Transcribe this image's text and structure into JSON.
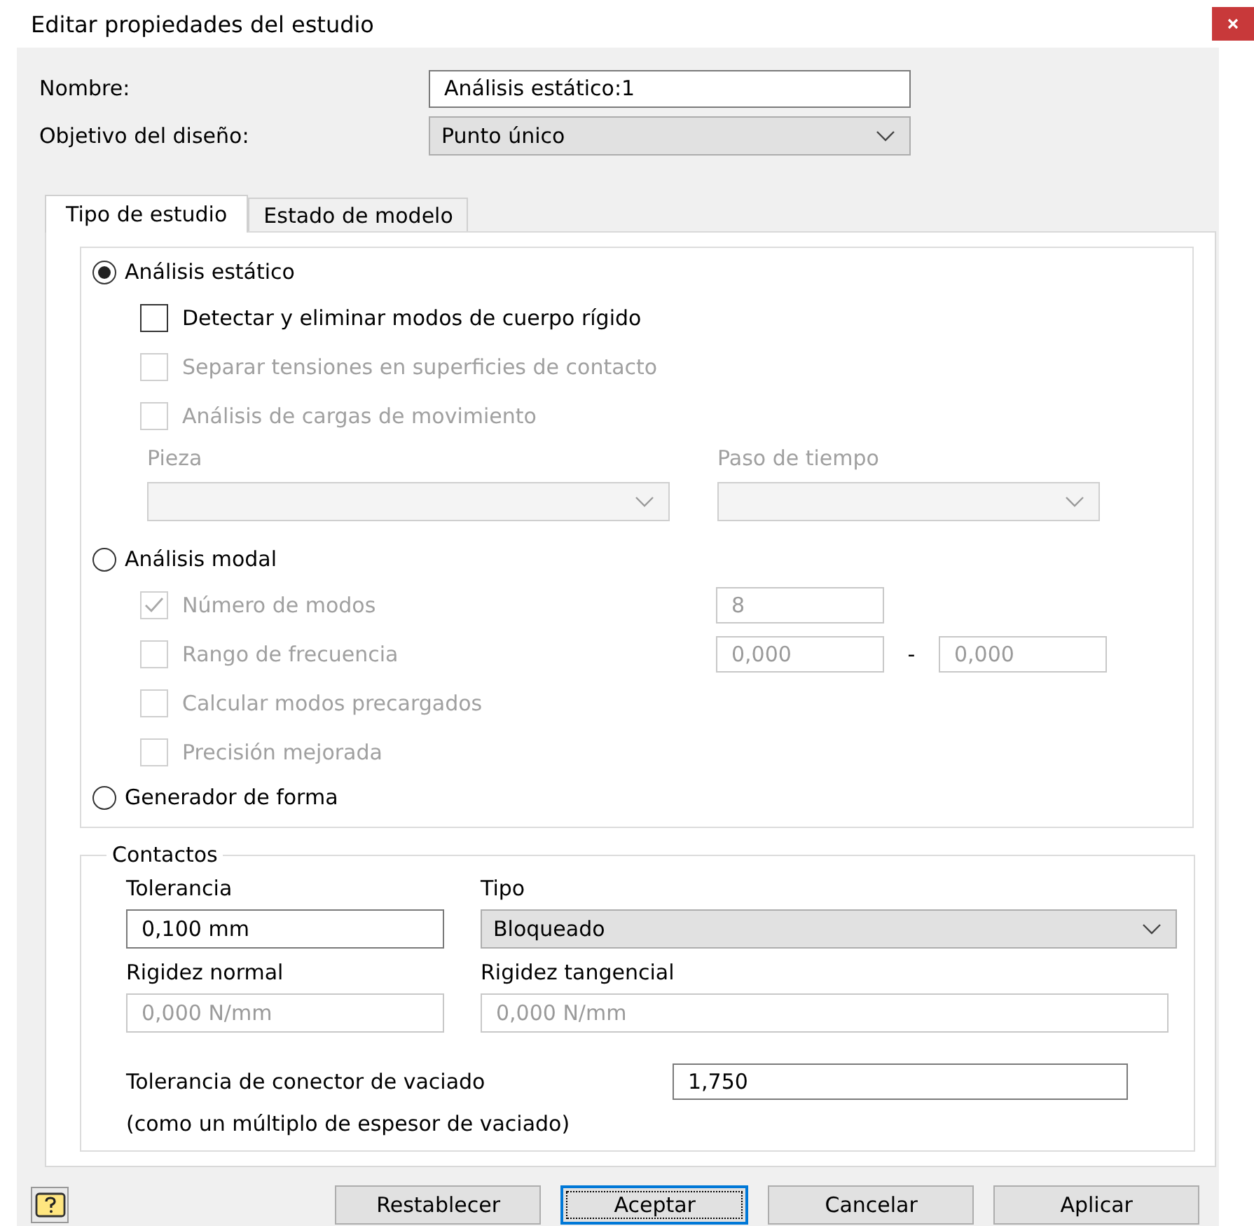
{
  "window": {
    "title": "Editar propiedades del estudio"
  },
  "name_field": {
    "label": "Nombre:",
    "value": "Análisis estático:1"
  },
  "objective_field": {
    "label": "Objetivo del diseño:",
    "value": "Punto único"
  },
  "tabs": [
    {
      "label": "Tipo de estudio",
      "selected": true
    },
    {
      "label": "Estado de modelo",
      "selected": false
    }
  ],
  "analysis_types": [
    {
      "label": "Análisis estático",
      "selected": true,
      "rows": [
        {
          "kind": "checkbox",
          "label": "Detectar y eliminar modos de cuerpo rígido",
          "checked": false,
          "disabled": false
        },
        {
          "kind": "checkbox",
          "label": "Separar tensiones en superficies de contacto",
          "checked": false,
          "disabled": true
        },
        {
          "kind": "checkbox",
          "label": "Análisis de cargas de movimiento",
          "checked": false,
          "disabled": true
        },
        {
          "kind": "selects",
          "selects": [
            {
              "label": "Pieza",
              "disabled": true
            },
            {
              "label": "Paso de tiempo",
              "disabled": true
            }
          ]
        }
      ]
    },
    {
      "label": "Análisis modal",
      "selected": false,
      "rows": [
        {
          "kind": "checkbox",
          "label": "Número de modos",
          "checked": true,
          "disabled": true,
          "values": [
            "8"
          ]
        },
        {
          "kind": "checkbox",
          "label": "Rango de frecuencia",
          "checked": false,
          "disabled": true,
          "values": [
            "0,000",
            "0,000"
          ],
          "separator": "-"
        },
        {
          "kind": "checkbox",
          "label": "Calcular modos precargados",
          "checked": false,
          "disabled": true
        },
        {
          "kind": "checkbox",
          "label": "Precisión mejorada",
          "checked": false,
          "disabled": true
        }
      ]
    },
    {
      "label": "Generador de forma",
      "selected": false
    }
  ],
  "contacts": {
    "title": "Contactos",
    "tolerance": {
      "label": "Tolerancia",
      "value": "0,100 mm",
      "disabled": false
    },
    "type": {
      "label": "Tipo",
      "value": "Bloqueado"
    },
    "normal_stiffness": {
      "label": "Rigidez normal",
      "value": "0,000 N/mm",
      "disabled": true
    },
    "tangential_stiffness": {
      "label": "Rigidez tangencial",
      "value": "0,000 N/mm",
      "disabled": true
    },
    "shell_tolerance": {
      "label": "Tolerancia de conector de vaciado",
      "note": "(como un múltiplo de espesor de vaciado)",
      "value": "1,750"
    }
  },
  "buttons": [
    {
      "label": "Restablecer",
      "default": false
    },
    {
      "label": "Aceptar",
      "default": true
    },
    {
      "label": "Cancelar",
      "default": false
    },
    {
      "label": "Aplicar",
      "default": false
    }
  ]
}
